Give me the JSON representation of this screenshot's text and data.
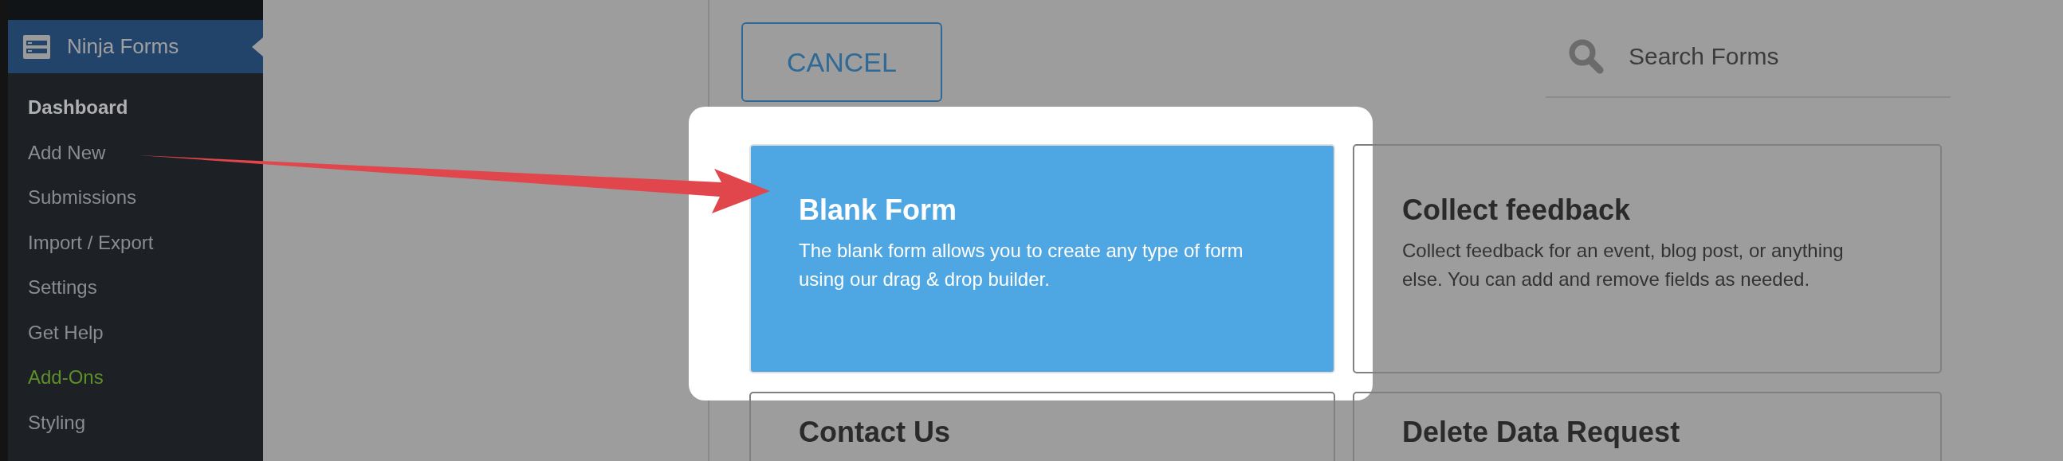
{
  "sidebar": {
    "header": "Ninja Forms",
    "items": [
      {
        "label": "Dashboard",
        "selected": true,
        "kind": "page"
      },
      {
        "label": "Add New",
        "selected": false,
        "kind": "page"
      },
      {
        "label": "Submissions",
        "selected": false,
        "kind": "page"
      },
      {
        "label": "Import / Export",
        "selected": false,
        "kind": "page"
      },
      {
        "label": "Settings",
        "selected": false,
        "kind": "page"
      },
      {
        "label": "Get Help",
        "selected": false,
        "kind": "page"
      },
      {
        "label": "Add-Ons",
        "selected": false,
        "kind": "addon"
      },
      {
        "label": "Styling",
        "selected": false,
        "kind": "page"
      }
    ]
  },
  "toolbar": {
    "cancel": "CANCEL",
    "search": {
      "placeholder": "Search Forms"
    }
  },
  "templates": [
    {
      "title": "Blank Form",
      "description": "The blank form allows you to create any type of form using our drag & drop builder.",
      "selected": true
    },
    {
      "title": "Collect feedback",
      "description": "Collect feedback for an event, blog post, or anything else. You can add and remove fields as needed.",
      "selected": false
    },
    {
      "title": "Contact Us",
      "selected": false
    },
    {
      "title": "Delete Data Request",
      "selected": false
    }
  ]
}
